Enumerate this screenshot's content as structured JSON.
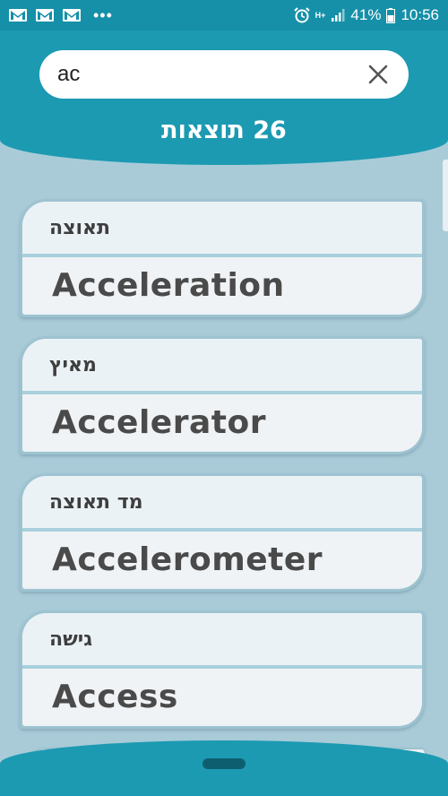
{
  "status_bar": {
    "battery": "41%",
    "time": "10:56",
    "network_label": "H+",
    "icons": [
      "gmail-icon",
      "gmail-icon",
      "gmail-icon",
      "more-dots-icon",
      "alarm-icon",
      "signal-icon",
      "battery-icon"
    ],
    "dots": "•••"
  },
  "search": {
    "value": "ac"
  },
  "results": {
    "count_label": "26 תוצאות"
  },
  "items": [
    {
      "hebrew": "תאוצה",
      "english": "Acceleration"
    },
    {
      "hebrew": "מאיץ",
      "english": "Accelerator"
    },
    {
      "hebrew": "מד תאוצה",
      "english": "Accelerometer"
    },
    {
      "hebrew": "גישה",
      "english": "Access"
    }
  ],
  "colors": {
    "header": "#1c9ab2",
    "status_bar": "#1590a8",
    "background": "#a9cbd8",
    "card": "#ebf2f6"
  }
}
